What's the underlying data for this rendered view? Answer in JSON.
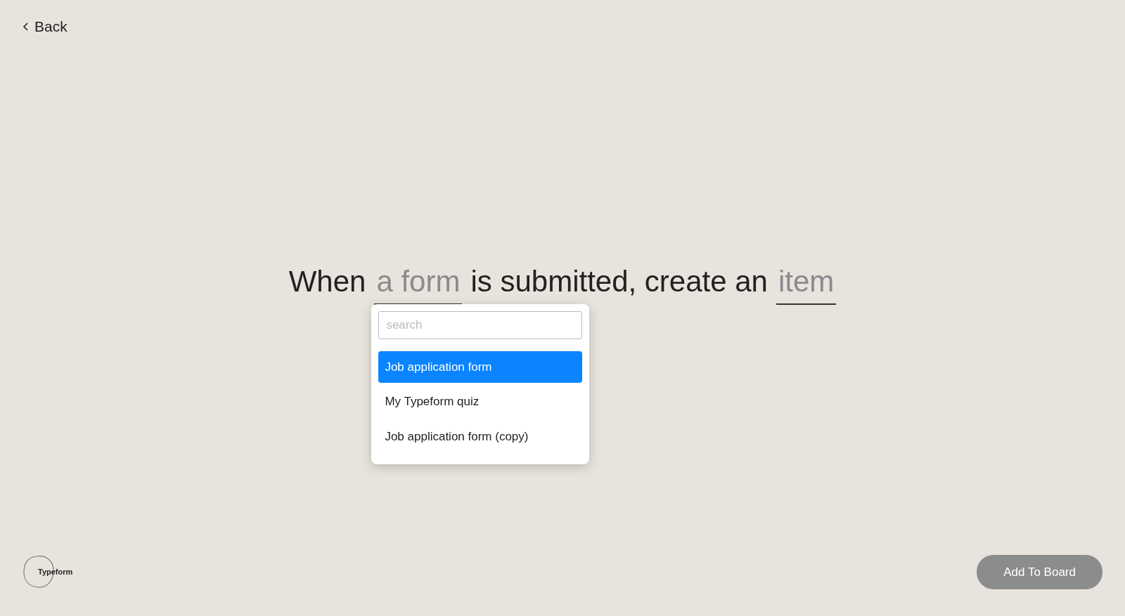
{
  "back": {
    "label": "Back"
  },
  "sentence": [
    {
      "kind": "text",
      "text": "When"
    },
    {
      "kind": "slot",
      "text": "a form",
      "open": true
    },
    {
      "kind": "text",
      "text": "is submitted, create an"
    },
    {
      "kind": "slot",
      "text": "item",
      "open": false
    }
  ],
  "dropdown": {
    "search": {
      "placeholder": "search"
    },
    "options": [
      {
        "label": "Job application form",
        "selected": true
      },
      {
        "label": "My Typeform quiz",
        "selected": false
      },
      {
        "label": "Job application form (copy)",
        "selected": false
      }
    ]
  },
  "logo": {
    "text": "Typeform"
  },
  "add_button": {
    "label": "Add To Board"
  }
}
